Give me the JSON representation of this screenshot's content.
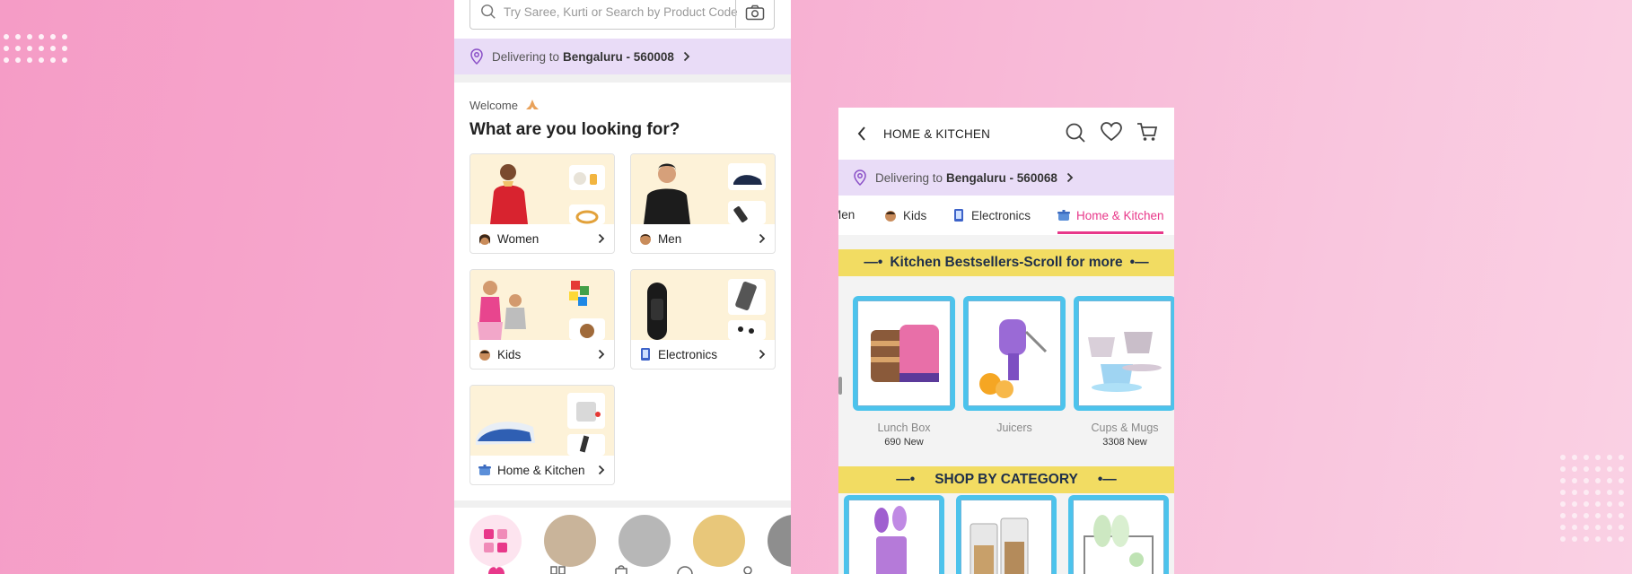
{
  "left_phone": {
    "search": {
      "placeholder": "Try Saree, Kurti or Search by Product Code"
    },
    "delivery": {
      "prefix": "Delivering to",
      "location": "Bengaluru - 560008"
    },
    "welcome": "Welcome",
    "heading": "What are you looking for?",
    "categories": [
      {
        "label": "Women",
        "icon": "woman-emoji-icon"
      },
      {
        "label": "Men",
        "icon": "man-emoji-icon"
      },
      {
        "label": "Kids",
        "icon": "child-emoji-icon"
      },
      {
        "label": "Electronics",
        "icon": "phone-emoji-icon"
      },
      {
        "label": "Home & Kitchen",
        "icon": "pot-emoji-icon"
      }
    ]
  },
  "right_phone": {
    "header": {
      "title": "HOME & KITCHEN"
    },
    "delivery": {
      "prefix": "Delivering to",
      "location": "Bengaluru - 560068"
    },
    "tabs": [
      {
        "label": "Men",
        "active": false
      },
      {
        "label": "Kids",
        "active": false
      },
      {
        "label": "Electronics",
        "active": false
      },
      {
        "label": "Home & Kitchen",
        "active": true
      }
    ],
    "banner_bestsellers": "Kitchen Bestsellers-Scroll for more",
    "products": [
      {
        "name": "Lunch Box",
        "count": "690 New"
      },
      {
        "name": "Juicers",
        "count": ""
      },
      {
        "name": "Cups & Mugs",
        "count": "3308 New"
      }
    ],
    "banner_category": "SHOP BY CATEGORY"
  },
  "colors": {
    "accent": "#e8388a",
    "delivery_bg": "#e9dcf7",
    "banner_bg": "#f2dc62",
    "product_frame": "#4cc3ec"
  }
}
